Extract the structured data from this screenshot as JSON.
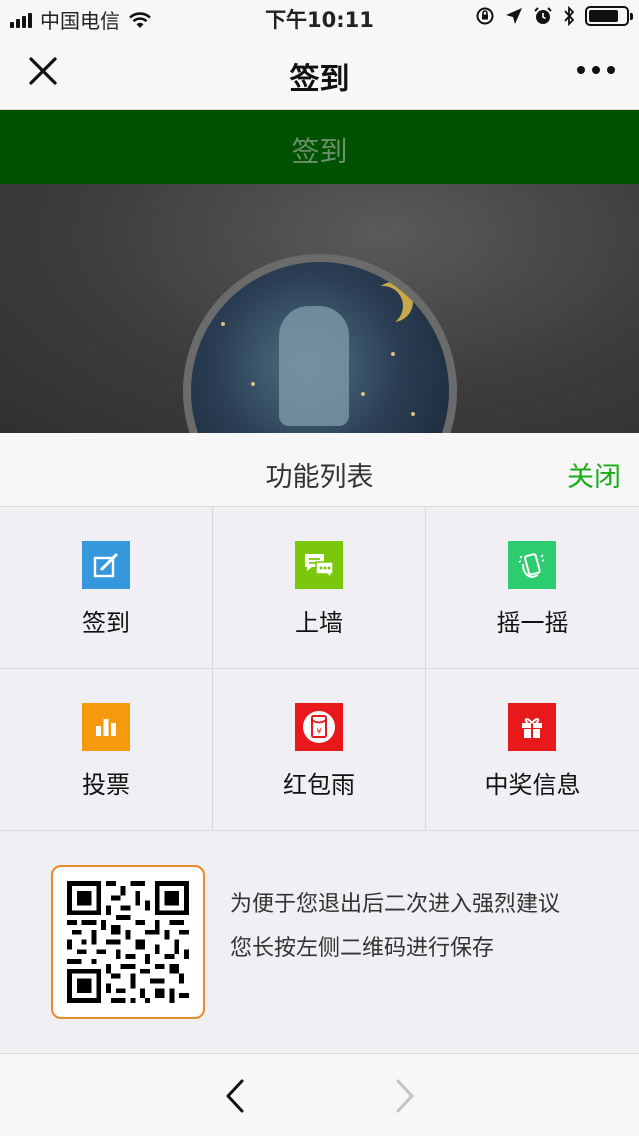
{
  "status_bar": {
    "carrier": "中国电信",
    "time": "下午10:11",
    "icons": [
      "signal-icon",
      "wifi-icon",
      "orientation-lock-icon",
      "location-icon",
      "alarm-icon",
      "bluetooth-icon",
      "battery-icon"
    ],
    "battery_level": 0.8
  },
  "nav": {
    "title": "签到",
    "close_icon": "close-icon",
    "more_icon": "more-icon"
  },
  "banner": {
    "title": "签到",
    "color": "#005200"
  },
  "panel": {
    "title": "功能列表",
    "close_label": "关闭",
    "accent": "#1aad19",
    "items": [
      {
        "label": "签到",
        "icon": "sign-in-icon",
        "color": "#3598dc"
      },
      {
        "label": "上墙",
        "icon": "chat-wall-icon",
        "color": "#7ac70c"
      },
      {
        "label": "摇一摇",
        "icon": "shake-icon",
        "color": "#2ecc71"
      },
      {
        "label": "投票",
        "icon": "vote-chart-icon",
        "color": "#f59a0c"
      },
      {
        "label": "红包雨",
        "icon": "red-envelope-icon",
        "color": "#e8191a"
      },
      {
        "label": "中奖信息",
        "icon": "gift-icon",
        "color": "#e8191a"
      }
    ]
  },
  "qr": {
    "line1": "为便于您退出后二次进入强烈建议",
    "line2": "您长按左侧二维码进行保存"
  },
  "toolbar": {
    "back_icon": "back-arrow-icon",
    "forward_icon": "forward-arrow-icon"
  }
}
